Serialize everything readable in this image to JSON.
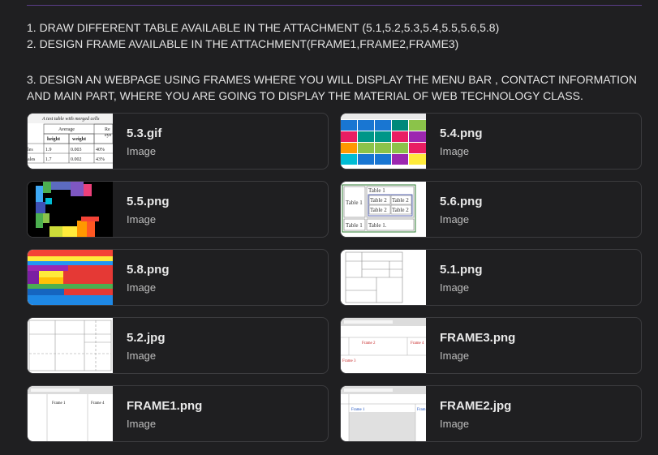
{
  "instructions": {
    "line1": "1. DRAW DIFFERENT TABLE AVAILABLE IN THE ATTACHMENT (5.1,5.2,5.3,5.4,5.5,5.6,5.8)",
    "line2": "2. DESIGN FRAME AVAILABLE IN THE ATTACHMENT(FRAME1,FRAME2,FRAME3)",
    "line3": "3. DESIGN AN WEBPAGE USING FRAMES WHERE YOU WILL DISPLAY THE MENU BAR , CONTACT INFORMATION AND MAIN PART, WHERE YOU ARE GOING TO DISPLAY THE MATERIAL OF WEB TECHNOLOGY CLASS."
  },
  "attachments": [
    {
      "name": "5.3.gif",
      "type": "Image",
      "thumb_text": [
        "A test table with merged cells",
        "Average",
        "height",
        "weight",
        "Re",
        "eye",
        "les",
        "1.9",
        "0.003",
        "40%",
        "ales",
        "1.7",
        "0.002",
        "43%"
      ]
    },
    {
      "name": "5.4.png",
      "type": "Image"
    },
    {
      "name": "5.5.png",
      "type": "Image"
    },
    {
      "name": "5.6.png",
      "type": "Image",
      "thumb_text": [
        "Table 1",
        "Table 1",
        "Table 2",
        "Table 2",
        "Table 2",
        "Table 2",
        "Table 1",
        "Table 1."
      ]
    },
    {
      "name": "5.8.png",
      "type": "Image"
    },
    {
      "name": "5.1.png",
      "type": "Image"
    },
    {
      "name": "5.2.jpg",
      "type": "Image"
    },
    {
      "name": "FRAME3.png",
      "type": "Image",
      "thumb_text": [
        "Frame 2",
        "Frame 4",
        "Frame 3"
      ]
    },
    {
      "name": "FRAME1.png",
      "type": "Image",
      "thumb_text": [
        "Frame 1",
        "Frame 4"
      ]
    },
    {
      "name": "FRAME2.jpg",
      "type": "Image",
      "thumb_text": [
        "Frame 1",
        "Fram"
      ]
    }
  ]
}
